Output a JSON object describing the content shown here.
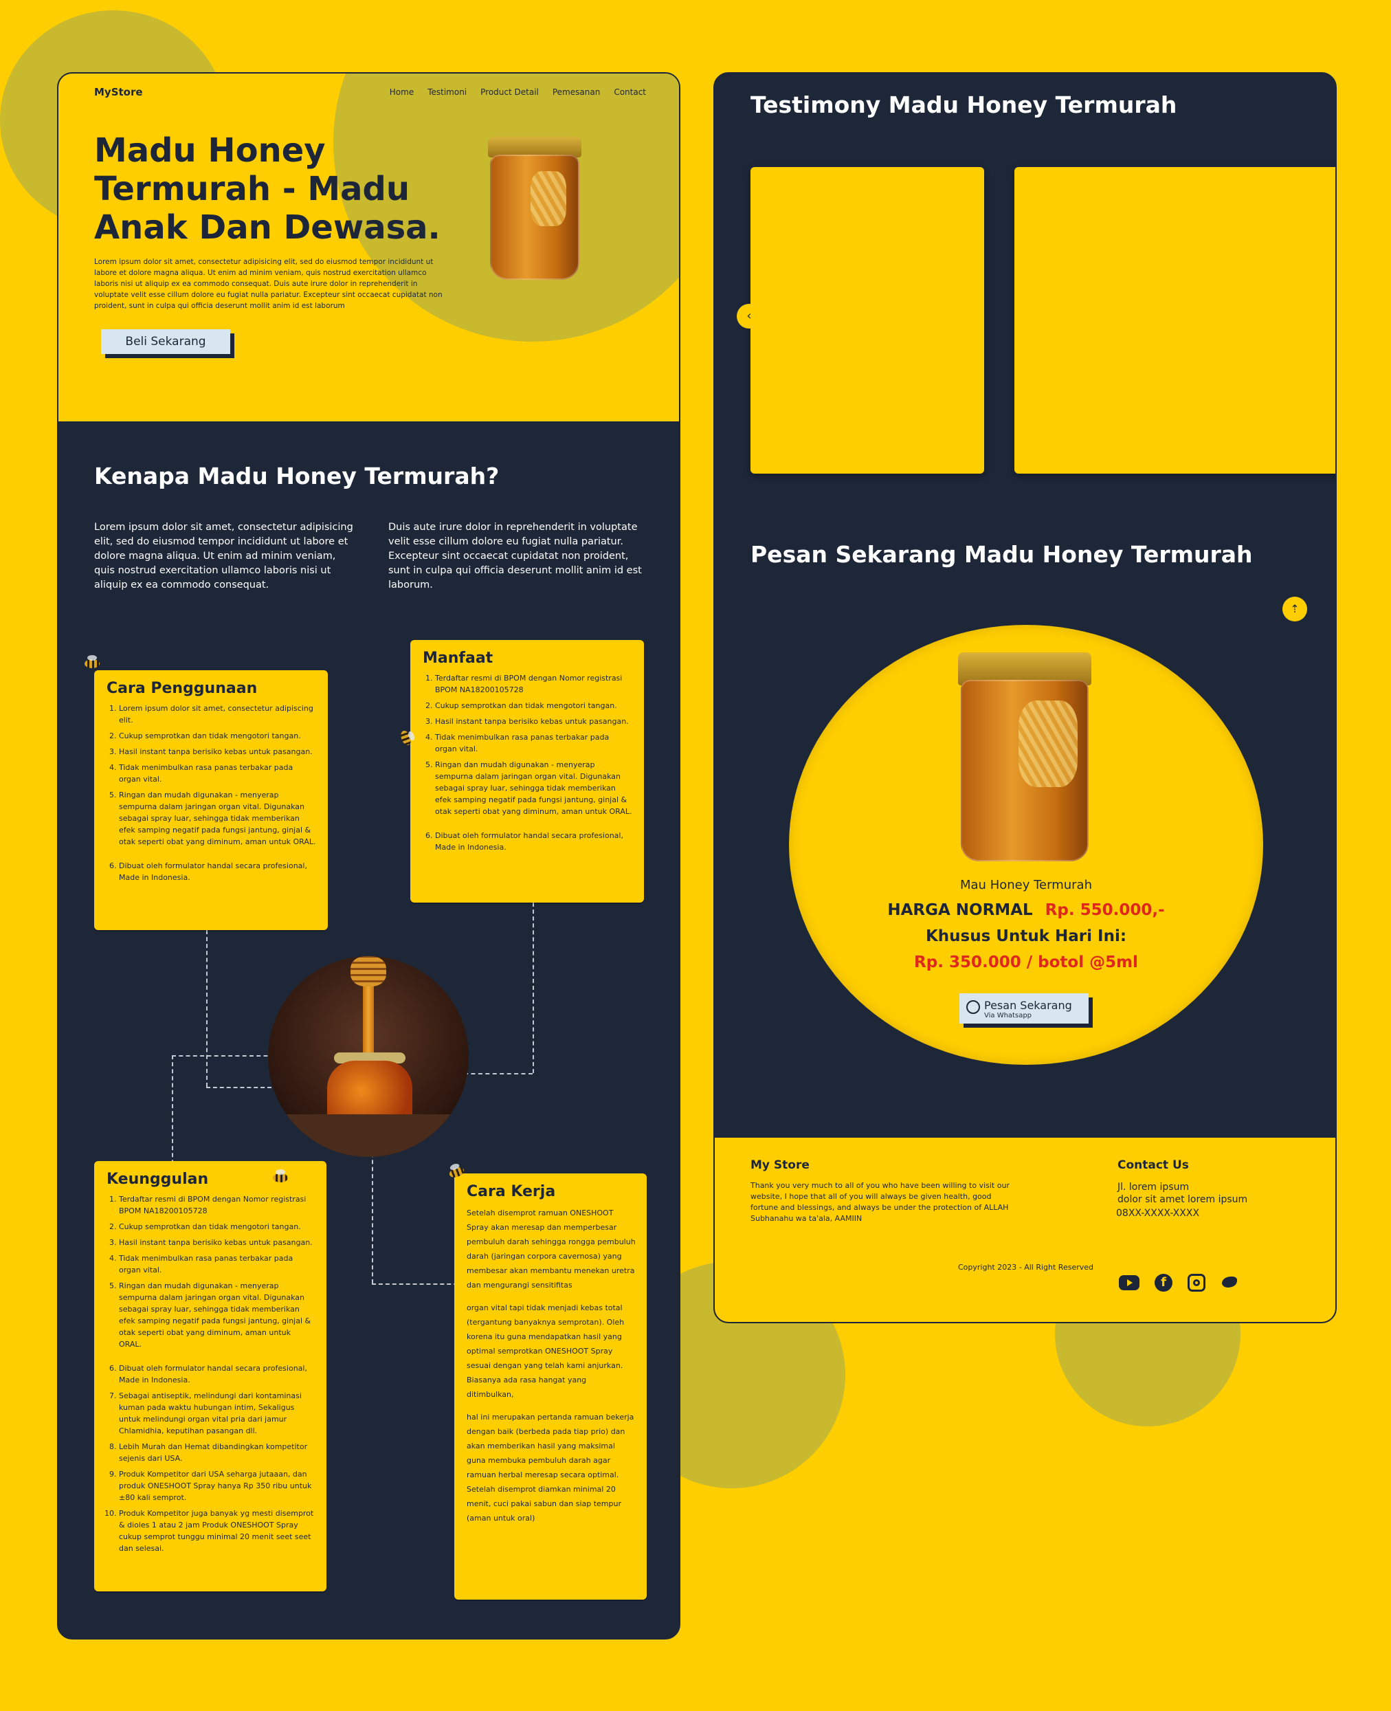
{
  "left": {
    "brand": "MyStore",
    "nav": [
      "Home",
      "Testimoni",
      "Product Detail",
      "Pemesanan",
      "Contact"
    ],
    "hero_title": "Madu Honey Termurah - Madu Anak Dan Dewasa.",
    "hero_text": "Lorem ipsum dolor sit amet, consectetur adipisicing elit, sed do eiusmod tempor incididunt ut labore et dolore magna aliqua. Ut enim ad minim veniam, quis nostrud exercitation ullamco laboris nisi ut aliquip ex ea commodo consequat. Duis aute irure dolor in reprehenderit in voluptate velit esse cillum dolore eu fugiat nulla pariatur. Excepteur sint occaecat cupidatat non proident, sunt in culpa qui officia deserunt mollit anim id est laborum",
    "hero_button": "Beli Sekarang",
    "why_title": "Kenapa Madu Honey Termurah?",
    "why_left": "Lorem ipsum dolor sit amet, consectetur adipisicing elit, sed do eiusmod tempor incididunt ut labore et dolore magna aliqua. Ut enim ad minim veniam, quis nostrud exercitation ullamco laboris nisi ut aliquip ex ea commodo consequat.",
    "why_right": "Duis aute irure dolor in reprehenderit in voluptate velit esse cillum dolore eu fugiat nulla pariatur. Excepteur sint occaecat cupidatat non proident, sunt in culpa qui officia deserunt mollit anim id est laborum."
  },
  "cards": {
    "cara": {
      "title": "Cara Penggunaan",
      "items": [
        "Lorem ipsum dolor sit amet, consectetur adipiscing elit.",
        "Cukup semprotkan dan tidak mengotori tangan.",
        "Hasil instant tanpa berisiko kebas untuk pasangan.",
        "Tidak menimbulkan rasa panas terbakar pada organ vital.",
        "Ringan dan mudah digunakan - menyerap sempurna dalam jaringan organ vital. Digunakan sebagai spray luar, sehingga tidak memberikan efek samping negatif pada fungsi jantung, ginjal & otak seperti obat yang diminum, aman untuk ORAL.",
        "Dibuat oleh formulator handal secara profesional, Made in Indonesia."
      ]
    },
    "manfaat": {
      "title": "Manfaat",
      "items": [
        "Terdaftar resmi di BPOM dengan Nomor registrasi BPOM NA18200105728",
        "Cukup semprotkan dan tidak mengotori tangan.",
        "Hasil instant tanpa berisiko kebas untuk pasangan.",
        "Tidak menimbulkan rasa panas terbakar pada organ vital.",
        "Ringan dan mudah digunakan - menyerap sempurna dalam jaringan organ vital. Digunakan sebagai spray luar, sehingga tidak memberikan efek samping negatif pada fungsi jantung, ginjal & otak seperti obat yang diminum, aman untuk ORAL.",
        "Dibuat oleh formulator handal secara profesional, Made in Indonesia."
      ]
    },
    "keunggulan": {
      "title": "Keunggulan",
      "items": [
        "Terdaftar resmi di BPOM dengan Nomor registrasi BPOM NA18200105728",
        "Cukup semprotkan dan tidak mengotori tangan.",
        "Hasil instant tanpa berisiko kebas untuk pasangan.",
        "Tidak menimbulkan rasa panas terbakar pada organ vital.",
        "Ringan dan mudah digunakan - menyerap sempurna dalam jaringan organ vital. Digunakan sebagai spray luar, sehingga tidak memberikan efek samping negatif pada fungsi jantung, ginjal & otak seperti obat yang diminum, aman untuk ORAL.",
        "Dibuat oleh formulator handal secara profesional, Made in Indonesia.",
        "Sebagai antiseptik, melindungi dari kontaminasi kuman pada waktu hubungan intim, Sekaligus untuk melindungi organ vital pria dari jamur Chlamidhia, keputihan pasangan dll.",
        "Lebih Murah dan Hemat dibandingkan kompetitor sejenis dari USA.",
        "Produk Kompetitor dari USA seharga jutaaan, dan produk ONESHOOT Spray hanya Rp 350 ribu untuk ±80 kali semprot.",
        "Produk Kompetitor juga banyak yg mesti disemprot & dioles 1 atau 2 jam Produk ONESHOOT Spray cukup semprot tunggu minimal 20 menit seet seet dan selesai."
      ]
    },
    "kerja": {
      "title": "Cara Kerja",
      "p1": "Setelah disemprot ramuan ONESHOOT Spray akan meresap dan memperbesar pembuluh darah sehingga rongga pembuluh darah (jaringan corpora cavernosa) yang membesar akan membantu menekan uretra dan mengurangi sensitifitas",
      "p2": "organ vital tapi tidak menjadi kebas total (tergantung banyaknya semprotan). Oleh korena itu guna mendapatkan hasil yang optimal semprotkan ONESHOOT Spray sesuai dengan yang telah kami anjurkan. Biasanya ada rasa hangat yang ditimbulkan,",
      "p3": "hal ini merupakan pertanda ramuan bekerja dengan baik (berbeda pada tiap prio) dan akan memberikan hasil yang maksimal guna membuka pembuluh darah agar ramuan herbal meresap secara optimal. Setelah disemprot diamkan minimal 20 menit, cuci pakai sabun dan siap tempur (aman untuk oral)"
    }
  },
  "right": {
    "testimony_title": "Testimony Madu Honey Termurah",
    "prev_icon": "chevron-left-icon",
    "order_title": "Pesan Sekarang Madu Honey Termurah",
    "product_name": "Mau Honey Termurah",
    "normal_label": "HARGA NORMAL",
    "normal_price": "Rp. 550.000,-",
    "special_label": "Khusus Untuk Hari Ini:",
    "special_price": "Rp. 350.000 / botol @5ml",
    "order_button": "Pesan Sekarang",
    "order_button_sub": "Via Whatsapp",
    "footer": {
      "store_title": "My Store",
      "store_text": "Thank you very much to all of you who have been willing to visit our website, I hope that all of you will always be given health, good fortune and blessings, and always be under the protection of ALLAH Subhanahu wa ta'ala, AAMIIN",
      "contact_title": "Contact Us",
      "contact_address": "Jl. lorem ipsum",
      "contact_address2": "dolor sit amet lorem ipsum",
      "contact_phone": "08XX-XXXX-XXXX",
      "copyright": "Copyright 2023 - All Right Reserved",
      "social": [
        "youtube-icon",
        "facebook-icon",
        "instagram-icon",
        "twitter-icon"
      ]
    }
  },
  "colors": {
    "yellow": "#ffce00",
    "navy": "#1e2738",
    "olive": "#c9b92e",
    "price_red": "#e0271c"
  }
}
